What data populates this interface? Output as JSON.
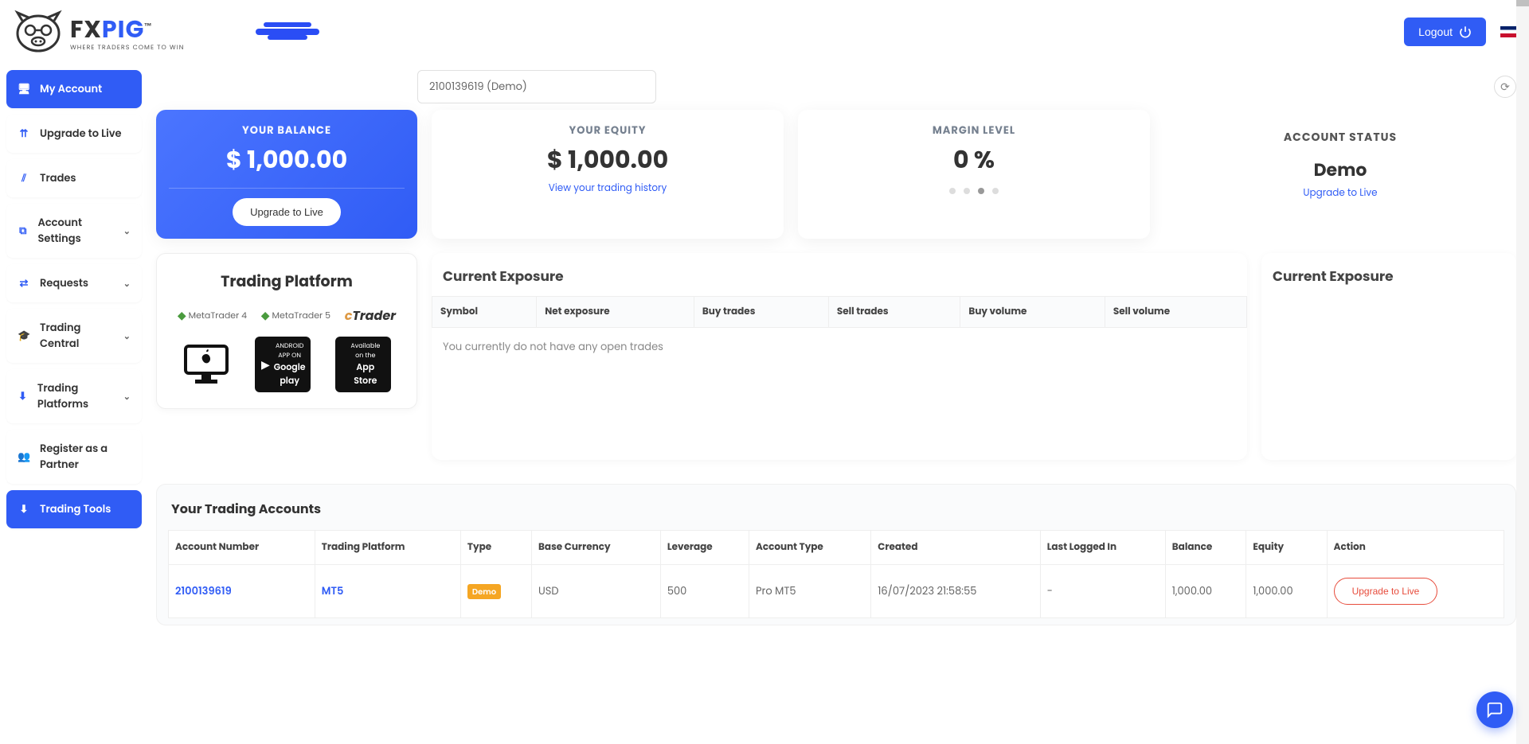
{
  "brand": {
    "name_plain": "FX",
    "name_accent": "PIG",
    "tm": "™",
    "tagline": "WHERE TRADERS COME TO WIN"
  },
  "top": {
    "logout": "Logout"
  },
  "sidebar": {
    "items": [
      {
        "label": "My Account"
      },
      {
        "label": "Upgrade to Live"
      },
      {
        "label": "Trades"
      },
      {
        "label": "Account Settings"
      },
      {
        "label": "Requests"
      },
      {
        "label": "Trading Central"
      },
      {
        "label": "Trading Platforms"
      },
      {
        "label": "Register as a Partner"
      },
      {
        "label": "Trading Tools"
      }
    ]
  },
  "account_select": "2100139619 (Demo)",
  "stats": {
    "balance": {
      "title": "YOUR BALANCE",
      "value": "$ 1,000.00",
      "cta": "Upgrade to Live"
    },
    "equity": {
      "title": "YOUR EQUITY",
      "value": "$ 1,000.00",
      "link": "View your trading history"
    },
    "margin": {
      "title": "MARGIN LEVEL",
      "value": "0 %"
    },
    "status": {
      "title": "ACCOUNT STATUS",
      "value": "Demo",
      "link": "Upgrade to Live"
    }
  },
  "platform": {
    "title": "Trading Platform",
    "mt4": "MetaTrader 4",
    "mt5": "MetaTrader 5",
    "ctrader_c": "c",
    "ctrader_rest": "Trader",
    "google_sm": "ANDROID APP ON",
    "google_big": "Google play",
    "apple_sm": "Available on the",
    "apple_big": "App Store"
  },
  "exposure": {
    "title": "Current Exposure",
    "headers": [
      "Symbol",
      "Net exposure",
      "Buy trades",
      "Sell trades",
      "Buy volume",
      "Sell volume"
    ],
    "empty": "You currently do not have any open trades"
  },
  "exposure_side": {
    "title": "Current Exposure"
  },
  "accounts": {
    "title": "Your Trading Accounts",
    "headers": [
      "Account Number",
      "Trading Platform",
      "Type",
      "Base Currency",
      "Leverage",
      "Account Type",
      "Created",
      "Last Logged In",
      "Balance",
      "Equity",
      "Action"
    ],
    "row": {
      "number": "2100139619",
      "platform": "MT5",
      "type_badge": "Demo",
      "currency": "USD",
      "leverage": "500",
      "account_type": "Pro MT5",
      "created": "16/07/2023 21:58:55",
      "last_login": "-",
      "balance": "1,000.00",
      "equity": "1,000.00",
      "action": "Upgrade to Live"
    }
  }
}
